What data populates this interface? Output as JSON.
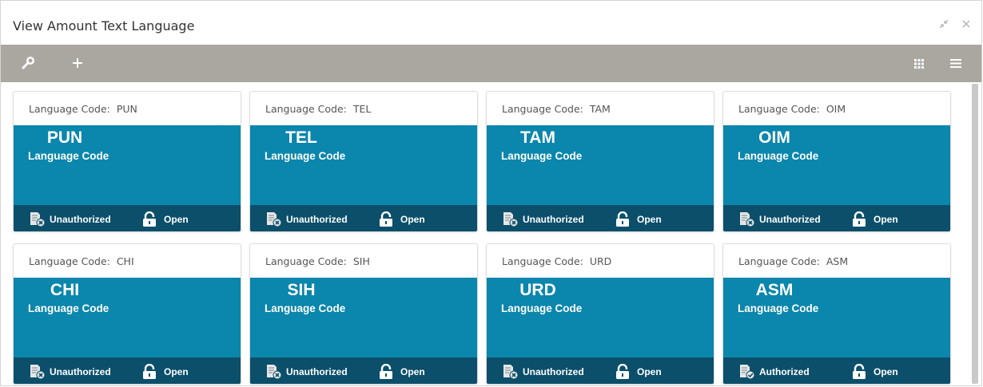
{
  "window": {
    "title": "View Amount Text Language"
  },
  "toolbar": {
    "left_icons": [
      "search-icon",
      "add-icon"
    ],
    "right_icons": [
      "grid-view-icon",
      "list-view-icon"
    ]
  },
  "colors": {
    "toolbar": "#aaa7a1",
    "card_body": "#0b86ad",
    "card_footer": "#0b4f6b"
  },
  "cards": [
    {
      "header_label": "Language Code:",
      "header_value": "PUN",
      "code": "PUN",
      "subtitle": "Language Code",
      "status": "Unauthorized",
      "lock": "Open"
    },
    {
      "header_label": "Language Code:",
      "header_value": "TEL",
      "code": "TEL",
      "subtitle": "Language Code",
      "status": "Unauthorized",
      "lock": "Open"
    },
    {
      "header_label": "Language Code:",
      "header_value": "TAM",
      "code": "TAM",
      "subtitle": "Language Code",
      "status": "Unauthorized",
      "lock": "Open"
    },
    {
      "header_label": "Language Code:",
      "header_value": "OIM",
      "code": "OIM",
      "subtitle": "Language Code",
      "status": "Unauthorized",
      "lock": "Open"
    },
    {
      "header_label": "Language Code:",
      "header_value": "CHI",
      "code": "CHI",
      "subtitle": "Language Code",
      "status": "Unauthorized",
      "lock": "Open"
    },
    {
      "header_label": "Language Code:",
      "header_value": "SIH",
      "code": "SIH",
      "subtitle": "Language Code",
      "status": "Unauthorized",
      "lock": "Open"
    },
    {
      "header_label": "Language Code:",
      "header_value": "URD",
      "code": "URD",
      "subtitle": "Language Code",
      "status": "Unauthorized",
      "lock": "Open"
    },
    {
      "header_label": "Language Code:",
      "header_value": "ASM",
      "code": "ASM",
      "subtitle": "Language Code",
      "status": "Authorized",
      "lock": "Open"
    }
  ]
}
